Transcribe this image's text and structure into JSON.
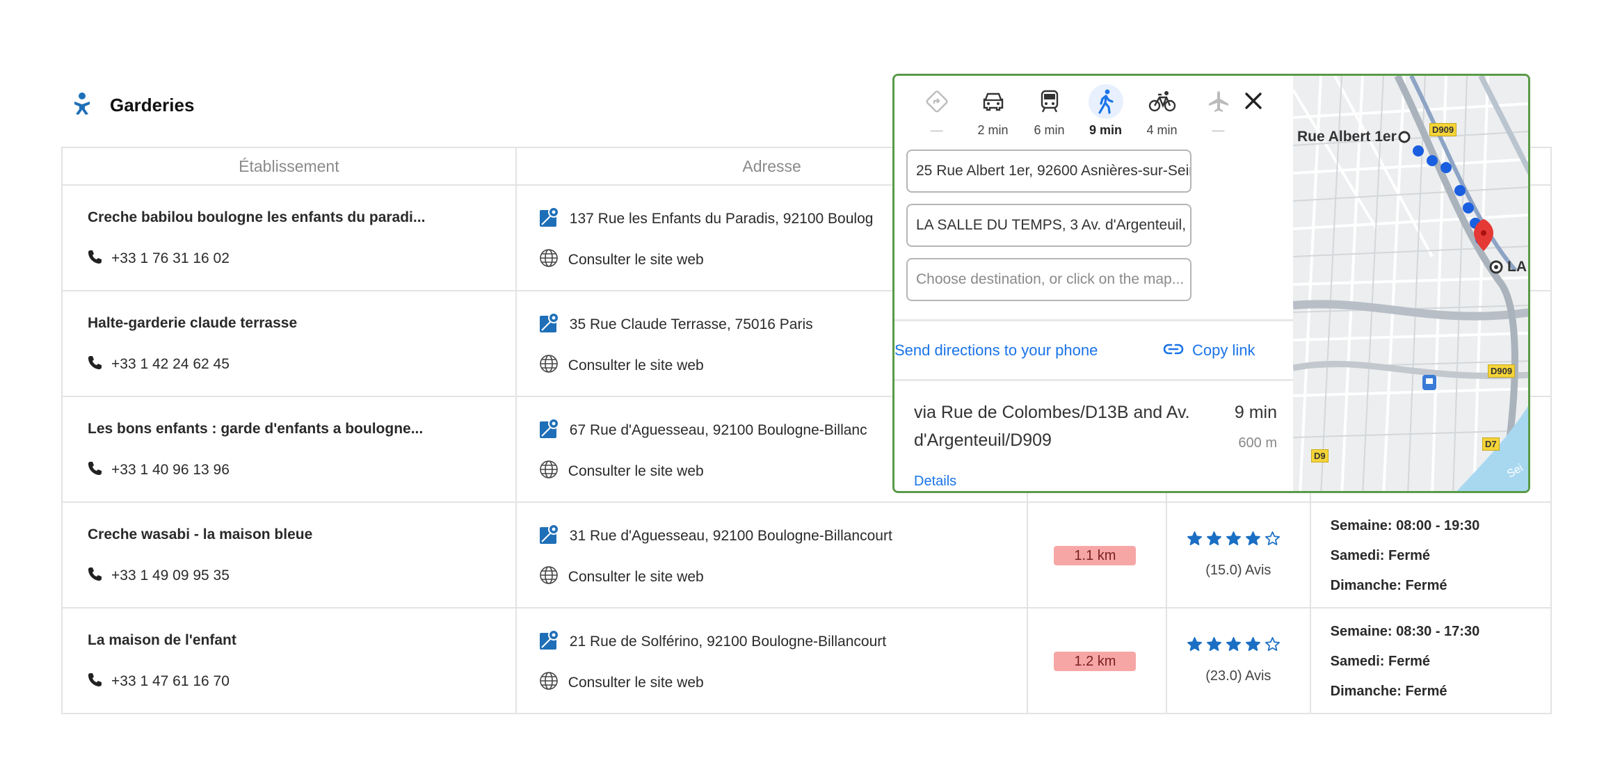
{
  "section": {
    "title": "Garderies",
    "icon": "child-icon"
  },
  "table": {
    "headers": [
      "Établissement",
      "Adresse",
      "",
      "",
      ""
    ],
    "rows": [
      {
        "name": "Creche babilou boulogne les enfants du paradi...",
        "phone": "+33 1 76 31 16 02",
        "address": "137 Rue les Enfants du Paradis, 92100 Boulog",
        "website": "Consulter le site web"
      },
      {
        "name": "Halte-garderie claude terrasse",
        "phone": "+33 1 42 24 62 45",
        "address": "35 Rue Claude Terrasse, 75016 Paris",
        "website": "Consulter le site web"
      },
      {
        "name": "Les bons enfants : garde d'enfants a boulogne...",
        "phone": "+33 1 40 96 13 96",
        "address": "67 Rue d'Aguesseau, 92100 Boulogne-Billanc",
        "website": "Consulter le site web"
      },
      {
        "name": "Creche wasabi - la maison bleue",
        "phone": "+33 1 49 09 95 35",
        "address": "31 Rue d'Aguesseau, 92100 Boulogne-Billancourt",
        "website": "Consulter le site web",
        "distance": "1.1 km",
        "rating": 4,
        "reviews": "(15.0) Avis",
        "hours": [
          "Semaine: 08:00 - 19:30",
          "Samedi: Fermé",
          "Dimanche: Fermé"
        ]
      },
      {
        "name": "La maison de l'enfant",
        "phone": "+33 1 47 61 16 70",
        "address": "21 Rue de Solférino, 92100 Boulogne-Billancourt",
        "website": "Consulter le site web",
        "distance": "1.2 km",
        "rating": 4,
        "reviews": "(23.0) Avis",
        "hours": [
          "Semaine: 08:30 - 17:30",
          "Samedi: Fermé",
          "Dimanche: Fermé"
        ]
      }
    ]
  },
  "directions": {
    "modes": [
      {
        "icon": "directions-icon",
        "label": "—"
      },
      {
        "icon": "car-icon",
        "label": "2 min"
      },
      {
        "icon": "transit-icon",
        "label": "6 min"
      },
      {
        "icon": "walk-icon",
        "label": "9 min",
        "active": true
      },
      {
        "icon": "bike-icon",
        "label": "4 min"
      },
      {
        "icon": "plane-icon",
        "label": "—"
      }
    ],
    "origin": "25 Rue Albert 1er, 92600 Asnières-sur-Sein",
    "destination": "LA SALLE DU TEMPS, 3 Av. d'Argenteuil, 92",
    "add_destination_placeholder": "Choose destination, or click on the map...",
    "send_to_phone": "Send directions to your phone",
    "copy_link": "Copy link",
    "route_via": "via Rue de Colombes/D13B and Av. d'Argenteuil/D909",
    "route_time": "9 min",
    "route_distance": "600 m",
    "details": "Details",
    "map": {
      "start_label": "Rue Albert 1er",
      "end_label": "LA",
      "badges": [
        "D909",
        "D909",
        "D9",
        "D7"
      ],
      "river_label": "Sei",
      "route_color": "#1a5fe0",
      "pin_color": "#e53935"
    }
  },
  "colors": {
    "accent": "#1a73e8",
    "brand_icon": "#1e6fb8",
    "star": "#1a6fc4",
    "distance_badge": "#f7a6a6",
    "popup_border": "#5a9a47"
  }
}
